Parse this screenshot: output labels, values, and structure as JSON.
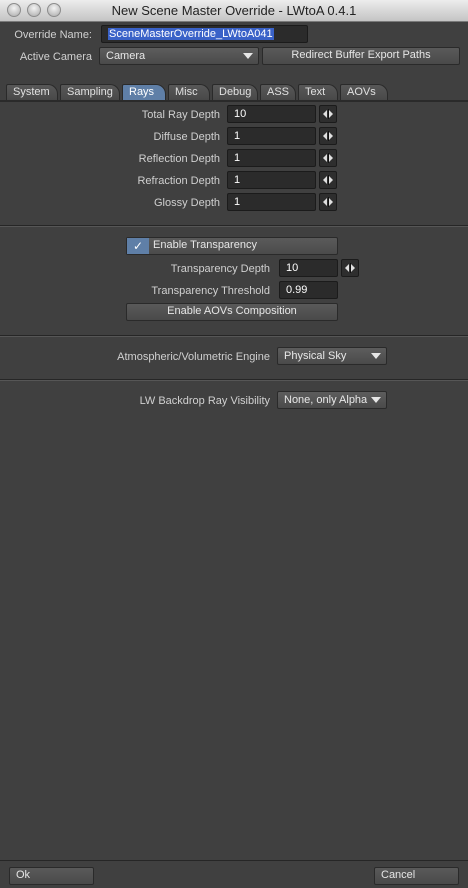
{
  "window": {
    "title": "New Scene Master Override - LWtoA 0.4.1"
  },
  "override_name": {
    "label": "Override Name:",
    "value": "SceneMasterOverride_LWtoA041"
  },
  "active_camera": {
    "label": "Active Camera",
    "value": "Camera"
  },
  "redirect_button": {
    "label": "Redirect Buffer Export Paths"
  },
  "tabs": [
    {
      "label": "System"
    },
    {
      "label": "Sampling"
    },
    {
      "label": "Rays"
    },
    {
      "label": "Misc"
    },
    {
      "label": "Debug"
    },
    {
      "label": "ASS"
    },
    {
      "label": "Text"
    },
    {
      "label": "AOVs"
    }
  ],
  "rays": {
    "total_ray_depth": {
      "label": "Total Ray Depth",
      "value": "10"
    },
    "diffuse_depth": {
      "label": "Diffuse Depth",
      "value": "1"
    },
    "reflection_depth": {
      "label": "Reflection Depth",
      "value": "1"
    },
    "refraction_depth": {
      "label": "Refraction Depth",
      "value": "1"
    },
    "glossy_depth": {
      "label": "Glossy Depth",
      "value": "1"
    }
  },
  "transparency": {
    "enable_label": "Enable Transparency",
    "checkmark": "✓",
    "depth": {
      "label": "Transparency Depth",
      "value": "10"
    },
    "threshold": {
      "label": "Transparency Threshold",
      "value": "0.99"
    },
    "enable_aovs_label": "Enable AOVs Composition"
  },
  "atmospheric": {
    "label": "Atmospheric/Volumetric Engine",
    "value": "Physical Sky"
  },
  "backdrop": {
    "label": "LW Backdrop Ray Visibility",
    "value": "None, only Alpha"
  },
  "footer": {
    "ok_label": "Ok",
    "cancel_label": "Cancel"
  },
  "colors": {
    "accent": "#5f7fa7",
    "panel": "#404040",
    "selection": "#3a62c8"
  }
}
